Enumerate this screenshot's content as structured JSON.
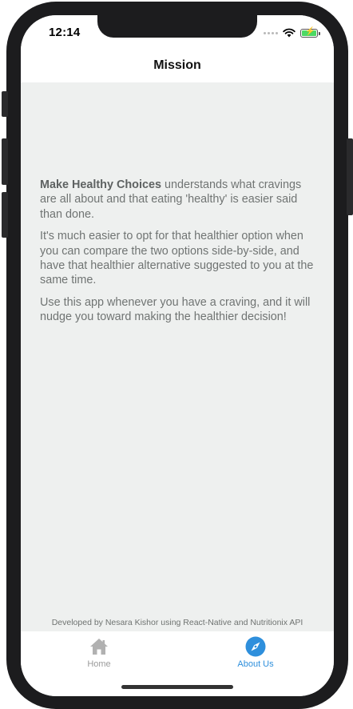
{
  "status_bar": {
    "time": "12:14"
  },
  "nav": {
    "title": "Mission"
  },
  "mission": {
    "app_name": "Make Healthy Choices",
    "paragraph1_rest": " understands what cravings are all about and that eating 'healthy' is easier said than done.",
    "paragraph2": "It's much easier to opt for that healthier option when you can compare the two options side-by-side, and have that healthier alternative suggested to you at the same time.",
    "paragraph3": "Use this app whenever you have a craving, and it will nudge you toward making the healthier decision!"
  },
  "footer": {
    "credit": "Developed by Nesara Kishor using React-Native and Nutritionix API"
  },
  "tabs": [
    {
      "label": "Home",
      "icon": "home-icon",
      "active": false
    },
    {
      "label": "About Us",
      "icon": "compass-icon",
      "active": true
    }
  ],
  "colors": {
    "active_tab": "#2e8fdc",
    "inactive_tab": "#9b9b9b",
    "screen_bg": "#eef0ef",
    "battery_fill": "#4cd964"
  }
}
